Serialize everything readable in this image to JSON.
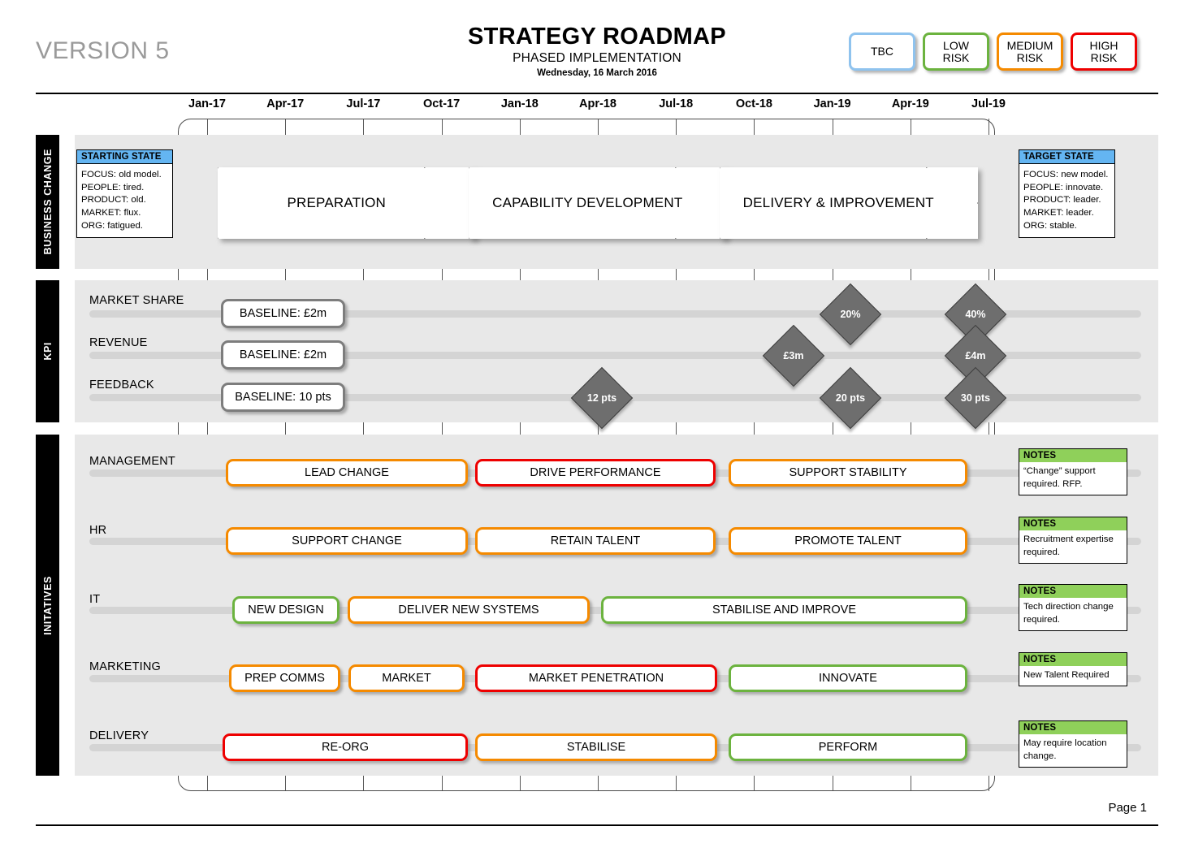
{
  "header": {
    "version": "VERSION 5",
    "title": "STRATEGY ROADMAP",
    "subtitle": "PHASED IMPLEMENTATION",
    "date": "Wednesday, 16 March 2016"
  },
  "legend": {
    "items": [
      {
        "label": "TBC",
        "color": "#8fc3ee"
      },
      {
        "label": "LOW\nRISK",
        "line1": "LOW",
        "line2": "RISK",
        "color": "#6cb33f"
      },
      {
        "label": "MEDIUM\nRISK",
        "line1": "MEDIUM",
        "line2": "RISK",
        "color": "#f58a00"
      },
      {
        "label": "HIGH\nRISK",
        "line1": "HIGH",
        "line2": "RISK",
        "color": "#ee0000"
      }
    ]
  },
  "timeline": {
    "ticks": [
      "Jan-17",
      "Apr-17",
      "Jul-17",
      "Oct-17",
      "Jan-18",
      "Apr-18",
      "Jul-18",
      "Oct-18",
      "Jan-19",
      "Apr-19",
      "Jul-19"
    ]
  },
  "bands": {
    "business_change": "BUSINESS CHANGE",
    "kpi": "KPI",
    "initiatives": "INITATIVES"
  },
  "starting_state": {
    "heading": "STARTING STATE",
    "lines": [
      "FOCUS: old model.",
      "PEOPLE: tired.",
      "PRODUCT: old.",
      "MARKET: flux.",
      "ORG: fatigued."
    ]
  },
  "target_state": {
    "heading": "TARGET STATE",
    "lines": [
      "FOCUS: new  model.",
      "PEOPLE: innovate.",
      "PRODUCT: leader.",
      "MARKET: leader.",
      "ORG: stable."
    ]
  },
  "phases": [
    {
      "label": "PREPARATION"
    },
    {
      "label": "CAPABILITY DEVELOPMENT"
    },
    {
      "label": "DELIVERY & IMPROVEMENT"
    }
  ],
  "kpi_rows": [
    {
      "name": "MARKET SHARE",
      "baseline": "BASELINE: £2m",
      "milestones": [
        {
          "label": "20%"
        },
        {
          "label": "40%"
        }
      ]
    },
    {
      "name": "REVENUE",
      "baseline": "BASELINE: £2m",
      "milestones": [
        {
          "label": "£3m"
        },
        {
          "label": "£4m"
        }
      ]
    },
    {
      "name": "FEEDBACK",
      "baseline": "BASELINE: 10 pts",
      "milestones": [
        {
          "label": "12 pts"
        },
        {
          "label": "20 pts"
        },
        {
          "label": "30 pts"
        }
      ]
    }
  ],
  "initiative_rows": [
    {
      "name": "MANAGEMENT",
      "bars": [
        {
          "label": "LEAD CHANGE",
          "risk": "medium"
        },
        {
          "label": "DRIVE PERFORMANCE",
          "risk": "high"
        },
        {
          "label": "SUPPORT STABILITY",
          "risk": "medium"
        }
      ],
      "note": {
        "heading": "NOTES",
        "text": "“Change” support required. RFP."
      }
    },
    {
      "name": "HR",
      "bars": [
        {
          "label": "SUPPORT CHANGE",
          "risk": "medium"
        },
        {
          "label": "RETAIN TALENT",
          "risk": "medium"
        },
        {
          "label": "PROMOTE TALENT",
          "risk": "medium"
        }
      ],
      "note": {
        "heading": "NOTES",
        "text": "Recruitment expertise required."
      }
    },
    {
      "name": "IT",
      "bars": [
        {
          "label": "NEW DESIGN",
          "risk": "low"
        },
        {
          "label": "DELIVER NEW SYSTEMS",
          "risk": "medium"
        },
        {
          "label": "STABILISE AND IMPROVE",
          "risk": "low"
        }
      ],
      "note": {
        "heading": "NOTES",
        "text": "Tech direction change required."
      }
    },
    {
      "name": "MARKETING",
      "bars": [
        {
          "label": "PREP COMMS",
          "risk": "medium"
        },
        {
          "label": "MARKET",
          "risk": "medium"
        },
        {
          "label": "MARKET PENETRATION",
          "risk": "high"
        },
        {
          "label": "INNOVATE",
          "risk": "low"
        }
      ],
      "note": {
        "heading": "NOTES",
        "text": "New Talent Required"
      }
    },
    {
      "name": "DELIVERY",
      "bars": [
        {
          "label": "RE-ORG",
          "risk": "high"
        },
        {
          "label": "STABILISE",
          "risk": "medium"
        },
        {
          "label": "PERFORM",
          "risk": "low"
        }
      ],
      "note": {
        "heading": "NOTES",
        "text": "May require location change."
      }
    }
  ],
  "footer": {
    "page": "Page 1"
  }
}
